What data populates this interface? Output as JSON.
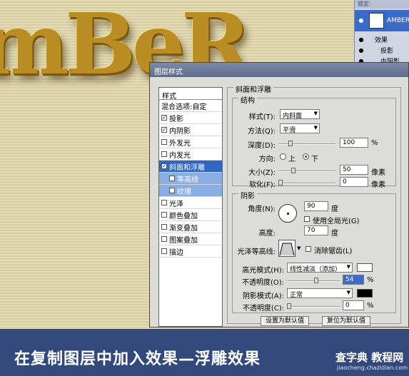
{
  "background": {
    "word": "AMBER",
    "display": "mBeR"
  },
  "layers_panel": {
    "header": "锁定:",
    "layer_name": "AMBER",
    "effects_label": "效果",
    "effect1": "投影",
    "effect2": "内阴影"
  },
  "dialog": {
    "title": "图层样式",
    "sidebar": {
      "header": "样式",
      "blend": "混合选项:自定",
      "items": [
        {
          "label": "投影",
          "checked": "✓"
        },
        {
          "label": "内阴影",
          "checked": "✓"
        },
        {
          "label": "外发光",
          "checked": ""
        },
        {
          "label": "内发光",
          "checked": ""
        },
        {
          "label": "斜面和浮雕",
          "checked": "✓"
        },
        {
          "label": "等高线",
          "checked": ""
        },
        {
          "label": "纹理",
          "checked": ""
        },
        {
          "label": "光泽",
          "checked": ""
        },
        {
          "label": "颜色叠加",
          "checked": ""
        },
        {
          "label": "渐变叠加",
          "checked": ""
        },
        {
          "label": "图案叠加",
          "checked": ""
        },
        {
          "label": "描边",
          "checked": ""
        }
      ]
    },
    "bevel": {
      "title": "斜面和浮雕",
      "structure": "结构",
      "style_label": "样式(T):",
      "style_value": "内斜面",
      "technique_label": "方法(Q):",
      "technique_value": "平滑",
      "depth_label": "深度(D):",
      "depth_value": "100",
      "depth_unit": "%",
      "direction_label": "方向:",
      "up": "上",
      "down": "下",
      "size_label": "大小(Z):",
      "size_value": "50",
      "size_unit": "像素",
      "soften_label": "软化(F):",
      "soften_value": "0",
      "soften_unit": "像素"
    },
    "shading": {
      "title": "阴影",
      "angle_label": "角度(N):",
      "angle_value": "90",
      "angle_unit": "度",
      "global_light": "使用全局光(G)",
      "altitude_label": "高度:",
      "altitude_value": "70",
      "altitude_unit": "度",
      "gloss_label": "光泽等高线:",
      "antialias": "消除锯齿(L)",
      "highlight_label": "高光模式(H):",
      "highlight_value": "线性减淡（添加）",
      "highlight_color": "#ffffff",
      "opacity1_label": "不透明度(O):",
      "opacity1_value": "54",
      "opacity1_unit": "%",
      "shadow_label": "阴影模式(A):",
      "shadow_value": "正常",
      "shadow_color": "#000000",
      "opacity2_label": "不透明度(C):",
      "opacity2_value": "0",
      "opacity2_unit": "%"
    },
    "buttons": {
      "default": "设置为默认值",
      "reset": "复位为默认值"
    }
  },
  "caption": {
    "text": "在复制图层中加入效果—浮雕效果"
  },
  "watermark": {
    "line1": "查字典 教程网",
    "line2": "jiaocheng.chazidian.com"
  }
}
